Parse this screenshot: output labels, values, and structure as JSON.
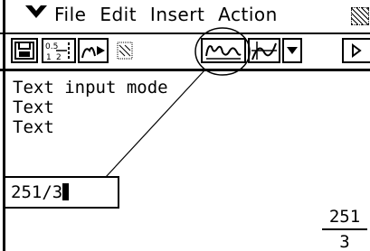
{
  "menu": {
    "items": [
      "File",
      "Edit",
      "Insert",
      "Action"
    ]
  },
  "toolbar": {
    "buttons": [
      {
        "name": "save-icon"
      },
      {
        "name": "fraction-decimal-toggle-icon"
      },
      {
        "name": "stroke-play-icon"
      },
      {
        "name": "pattern-icon"
      },
      {
        "name": "handwriting-input-icon"
      },
      {
        "name": "graph-icon"
      },
      {
        "name": "dropdown-arrow-icon"
      },
      {
        "name": "scroll-right-icon"
      }
    ]
  },
  "main": {
    "lines": [
      "Text input mode",
      "Text",
      "Text"
    ],
    "input_value": "251/3",
    "result": {
      "numerator": "251",
      "denominator": "3"
    }
  },
  "colors": {
    "foreground": "#000000",
    "background": "#ffffff"
  }
}
